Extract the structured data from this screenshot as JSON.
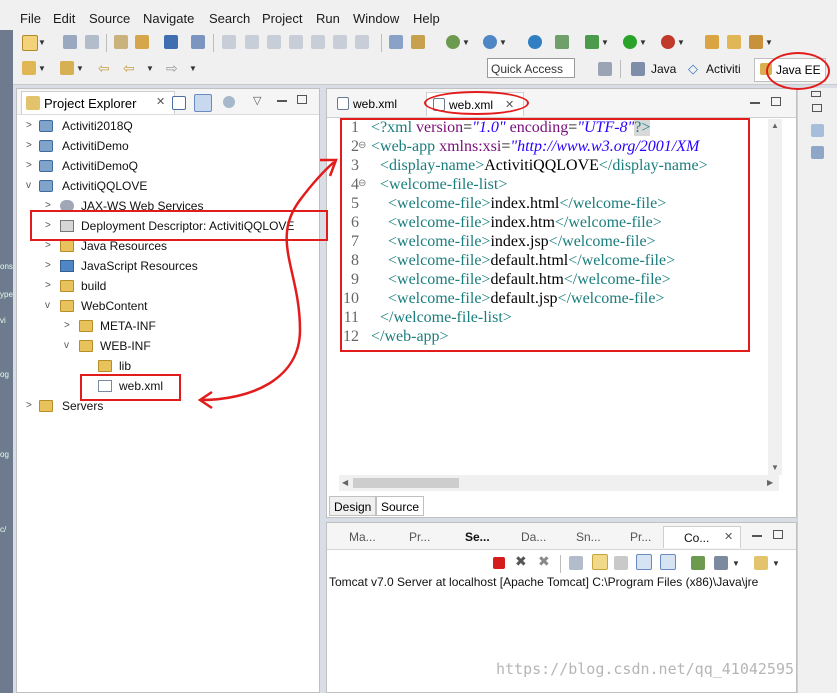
{
  "menu": [
    "File",
    "Edit",
    "Source",
    "Navigate",
    "Search",
    "Project",
    "Run",
    "Window",
    "Help"
  ],
  "toolbar": {
    "quick_access_placeholder": "Quick Access",
    "perspectives": [
      "Java",
      "Activiti",
      "Java EE"
    ]
  },
  "explorer": {
    "title": "Project Explorer",
    "items": [
      {
        "label": "Activiti2018Q",
        "arrow": ">"
      },
      {
        "label": "ActivitiDemo",
        "arrow": ">"
      },
      {
        "label": "ActivitiDemoQ",
        "arrow": ">"
      },
      {
        "label": "ActivitiQQLOVE",
        "arrow": "v"
      },
      {
        "label": "JAX-WS Web Services",
        "arrow": ">"
      },
      {
        "label": "Deployment Descriptor: ActivitiQQLOVE",
        "arrow": ">"
      },
      {
        "label": "Java Resources",
        "arrow": ">"
      },
      {
        "label": "JavaScript Resources",
        "arrow": ">"
      },
      {
        "label": "build",
        "arrow": ">"
      },
      {
        "label": "WebContent",
        "arrow": "v"
      },
      {
        "label": "META-INF",
        "arrow": ">"
      },
      {
        "label": "WEB-INF",
        "arrow": "v"
      },
      {
        "label": "lib",
        "arrow": ""
      },
      {
        "label": "web.xml",
        "arrow": ""
      },
      {
        "label": "Servers",
        "arrow": ">"
      }
    ]
  },
  "editor": {
    "tabs": [
      "web.xml",
      "web.xml"
    ],
    "bottom_tabs": [
      "Design",
      "Source"
    ],
    "line_numbers": [
      "1",
      "2",
      "3",
      "4",
      "5",
      "6",
      "7",
      "8",
      "9",
      "10",
      "11",
      "12"
    ],
    "code": {
      "l1_open": "<?xml ",
      "l1_attr1": "version",
      "l1_eq1": "=",
      "l1_val1": "\"1.0\"",
      "l1_attr2": " encoding",
      "l1_eq2": "=",
      "l1_val2": "\"UTF-8\"",
      "l1_close": "?>",
      "l2_open": "<web-app ",
      "l2_attr": "xmlns:xsi",
      "l2_eq": "=",
      "l2_val": "\"http://www.w3.org/2001/XM",
      "l3_open": "<display-name>",
      "l3_text": "ActivitiQQLOVE",
      "l3_close": "</display-name>",
      "l4": "<welcome-file-list>",
      "wf_open": "<welcome-file>",
      "wf_close": "</welcome-file>",
      "l5_text": "index.html",
      "l6_text": "index.htm",
      "l7_text": "index.jsp",
      "l8_text": "default.html",
      "l9_text": "default.htm",
      "l10_text": "default.jsp",
      "l11": "</welcome-file-list>",
      "l12": "</web-app>"
    }
  },
  "console": {
    "tabs": [
      "Ma...",
      "Pr...",
      "Se...",
      "Da...",
      "Sn...",
      "Pr...",
      "Co..."
    ],
    "output": "Tomcat v7.0 Server at localhost [Apache Tomcat] C:\\Program Files (x86)\\Java\\jre"
  },
  "watermark": "https://blog.csdn.net/qq_41042595",
  "colors": {
    "annotation_red": "#e21b1b",
    "xml_tag": "#1a7d7d",
    "xml_attr": "#7a0f7a",
    "xml_string": "#2a00ff"
  }
}
